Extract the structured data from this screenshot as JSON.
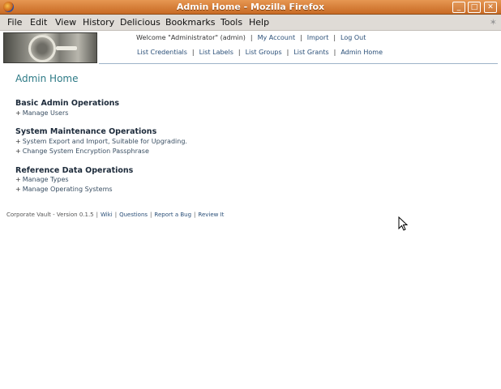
{
  "window": {
    "title": "Admin Home - Mozilla Firefox"
  },
  "menu": {
    "items": [
      "File",
      "Edit",
      "View",
      "History",
      "Delicious",
      "Bookmarks",
      "Tools",
      "Help"
    ]
  },
  "header": {
    "welcome": "Welcome \"Administrator\" (admin)",
    "top_links": [
      "My Account",
      "Import",
      "Log Out"
    ],
    "nav_links": [
      "List Credentials",
      "List Labels",
      "List Groups",
      "List Grants",
      "Admin Home"
    ],
    "separator": "|"
  },
  "page": {
    "title": "Admin Home",
    "sections": [
      {
        "heading": "Basic Admin Operations",
        "items": [
          "Manage Users"
        ]
      },
      {
        "heading": "System Maintenance Operations",
        "items": [
          "System Export and Import, Suitable for Upgrading.",
          "Change System Encryption Passphrase"
        ]
      },
      {
        "heading": "Reference Data Operations",
        "items": [
          "Manage Types",
          "Manage Operating Systems"
        ]
      }
    ],
    "bullet": "+"
  },
  "footer": {
    "version": "Corporate Vault - Version 0.1.5",
    "links": [
      "Wiki",
      "Questions",
      "Report a Bug",
      "Review It"
    ],
    "separator": "|"
  },
  "colors": {
    "titlebar": "#d77f38",
    "link": "#2a4f78",
    "page_title": "#2d7a86"
  }
}
